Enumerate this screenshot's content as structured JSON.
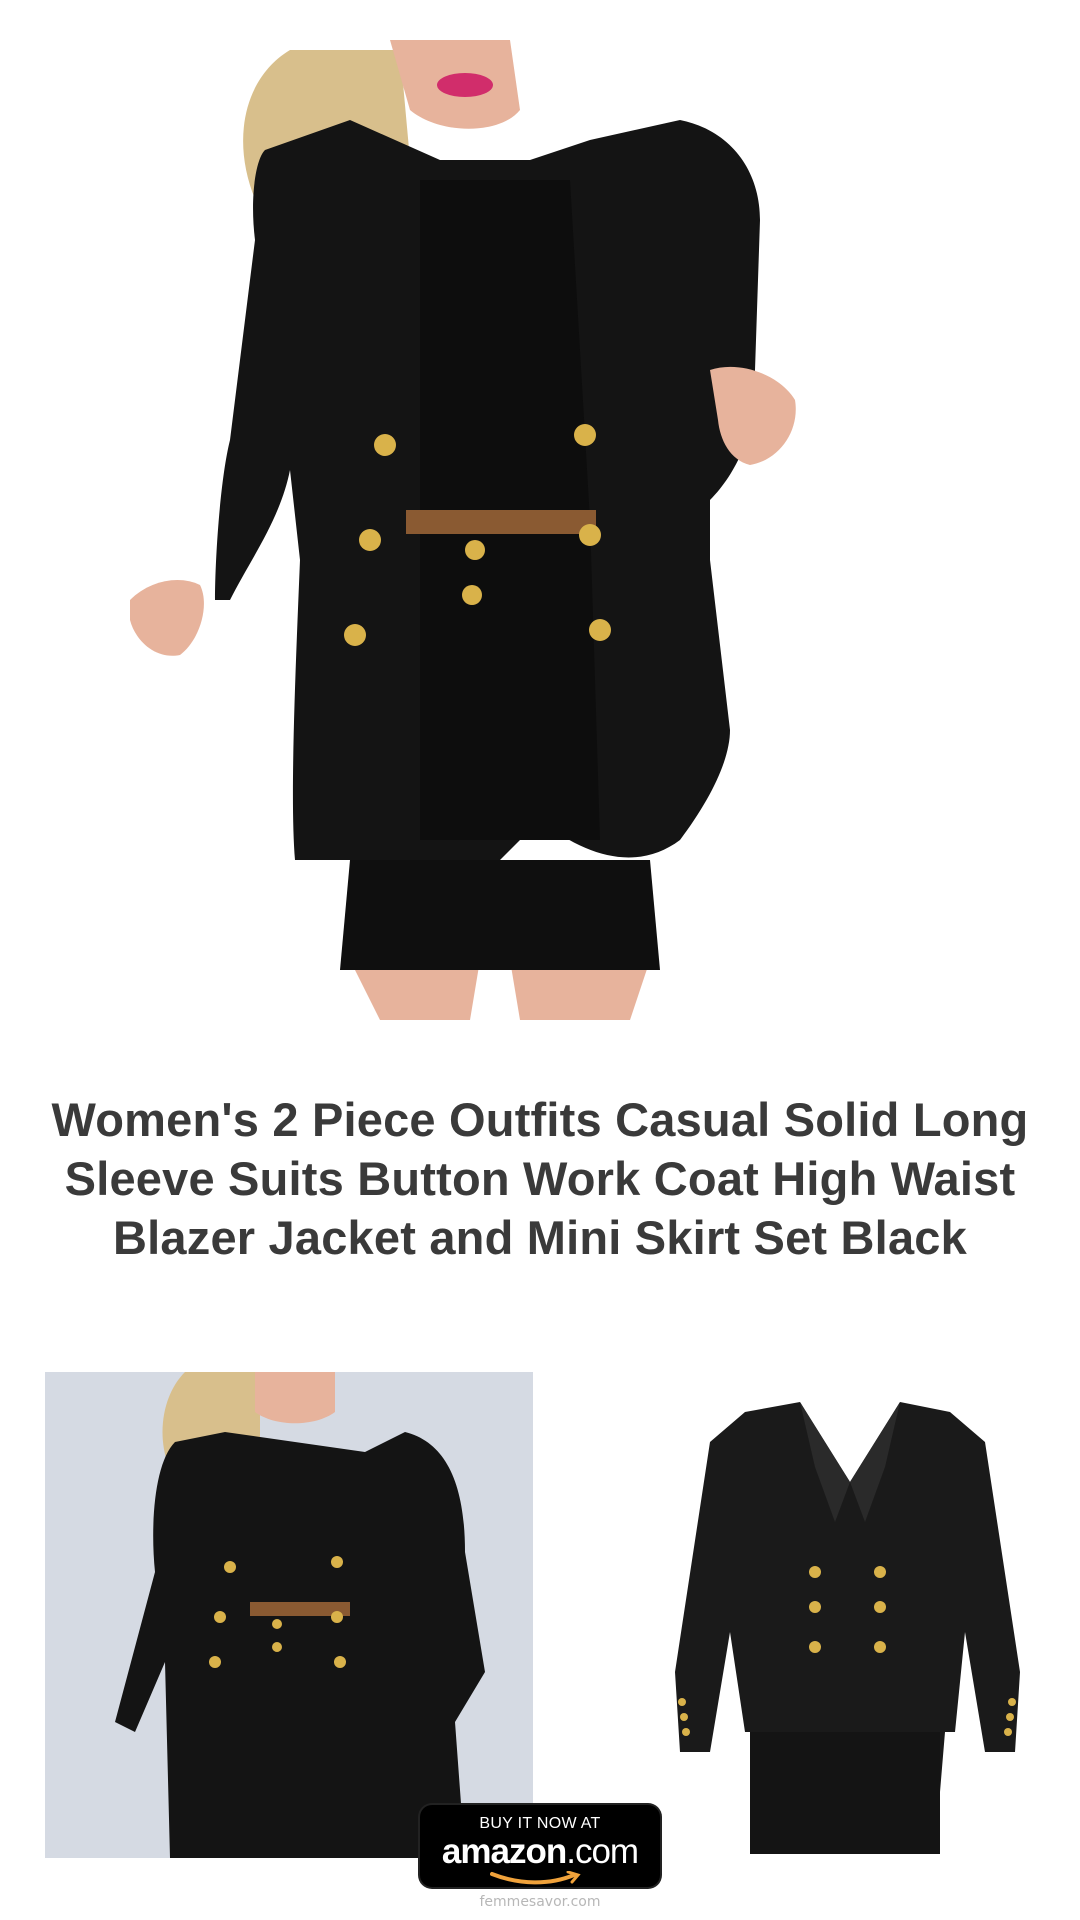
{
  "product": {
    "title": "Women's 2 Piece Outfits Casual Solid Long Sleeve Suits Button Work Coat High Waist Blazer Jacket and Mini Skirt Set Black",
    "main_image": {
      "icon": "model-blazer-outfit-photo",
      "fabric_color": "#141414",
      "button_color": "#d9b24a",
      "belt_color": "#8a5a32",
      "hair_color": "#d8bf8c",
      "skin_color": "#e7b39c"
    },
    "thumbnails": [
      {
        "icon": "model-wearing-blazer-set-photo",
        "background": "#d5dae3"
      },
      {
        "icon": "blazer-and-skirt-flatlay-photo",
        "background": "#ffffff"
      }
    ]
  },
  "cta": {
    "line1": "BUY IT NOW AT",
    "brand": "amazon",
    "domain": ".com",
    "smile_color": "#f0a23b"
  },
  "footer": {
    "site": "femmesavor.com"
  }
}
